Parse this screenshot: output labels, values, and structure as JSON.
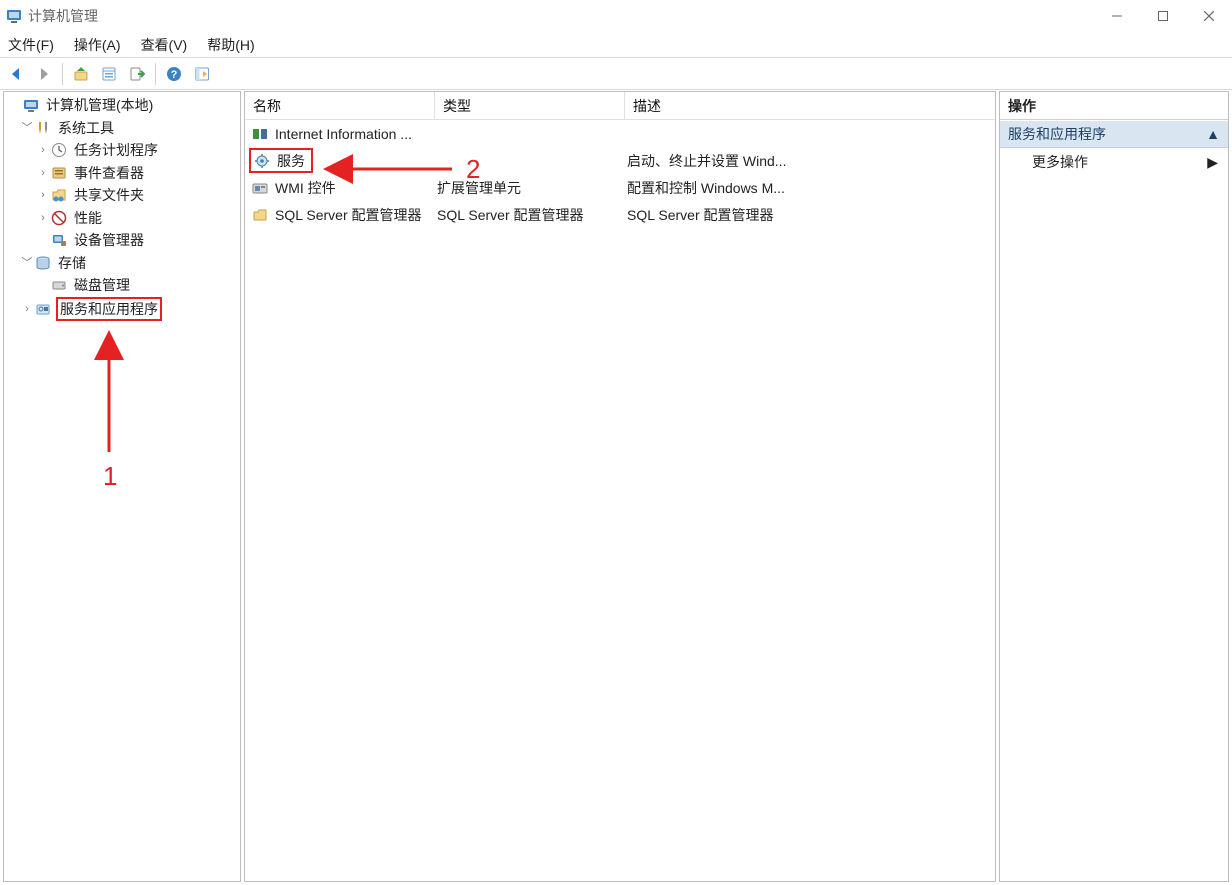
{
  "window": {
    "title": "计算机管理"
  },
  "menu": {
    "file": "文件(F)",
    "action": "操作(A)",
    "view": "查看(V)",
    "help": "帮助(H)"
  },
  "tree": {
    "root": "计算机管理(本地)",
    "systools": "系统工具",
    "task": "任务计划程序",
    "event": "事件查看器",
    "shared": "共享文件夹",
    "perf": "性能",
    "devmgr": "设备管理器",
    "storage": "存储",
    "disk": "磁盘管理",
    "svcapp": "服务和应用程序"
  },
  "list": {
    "col_name": "名称",
    "col_type": "类型",
    "col_desc": "描述",
    "rows": [
      {
        "name": "Internet Information ...",
        "type": "",
        "desc": ""
      },
      {
        "name": "服务",
        "type": "",
        "desc": "启动、终止并设置 Wind..."
      },
      {
        "name": "WMI 控件",
        "type": "扩展管理单元",
        "desc": "配置和控制 Windows M..."
      },
      {
        "name": "SQL Server 配置管理器",
        "type": "SQL Server 配置管理器",
        "desc": "SQL Server 配置管理器"
      }
    ]
  },
  "actions": {
    "title": "操作",
    "header": "服务和应用程序",
    "more": "更多操作"
  },
  "annotations": {
    "label1": "1",
    "label2": "2"
  }
}
